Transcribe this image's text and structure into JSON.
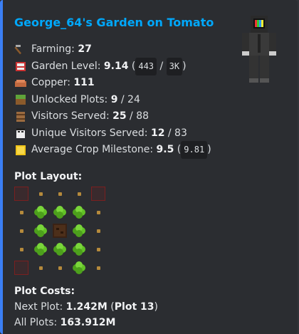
{
  "title": "George_64's Garden on Tomato",
  "stats": [
    {
      "icon": "hoe-icon",
      "label": "Farming:",
      "value": "27",
      "rest": "",
      "code": "",
      "code2": ""
    },
    {
      "icon": "composter-icon",
      "label": "Garden Level:",
      "value": "9.14",
      "rest": "",
      "code": "443",
      "code2": "3K"
    },
    {
      "icon": "copper-icon",
      "label": "Copper:",
      "value": "111",
      "rest": "",
      "code": "",
      "code2": ""
    },
    {
      "icon": "grass-block-icon",
      "label": "Unlocked Plots:",
      "value": "9",
      "rest": " / 24",
      "code": "",
      "code2": ""
    },
    {
      "icon": "barrel-icon",
      "label": "Visitors Served:",
      "value": "25",
      "rest": " / 88",
      "code": "",
      "code2": ""
    },
    {
      "icon": "villager-head-icon",
      "label": "Unique Visitors Served:",
      "value": "12",
      "rest": " / 83",
      "code": "",
      "code2": ""
    },
    {
      "icon": "gold-block-icon",
      "label": "Average Crop Milestone:",
      "value": "9.5",
      "rest": "",
      "code": "9.81",
      "code2": ""
    }
  ],
  "plot_layout": {
    "heading": "Plot Layout:",
    "grid": [
      [
        "empty",
        "seed",
        "seed",
        "seed",
        "empty"
      ],
      [
        "seed",
        "crop",
        "crop",
        "crop",
        "seed"
      ],
      [
        "seed",
        "crop",
        "barn",
        "crop",
        "seed"
      ],
      [
        "seed",
        "crop",
        "crop",
        "crop",
        "seed"
      ],
      [
        "empty",
        "seed",
        "seed",
        "crop",
        "seed"
      ]
    ]
  },
  "costs": {
    "heading": "Plot Costs:",
    "next_label": "Next Plot:",
    "next_value": "1.242M",
    "next_plot": "Plot 13",
    "all_label": "All Plots:",
    "all_value": "163.912M"
  },
  "colors": {
    "accent_bar": "#3b7ff5",
    "title": "#00a8fc"
  }
}
